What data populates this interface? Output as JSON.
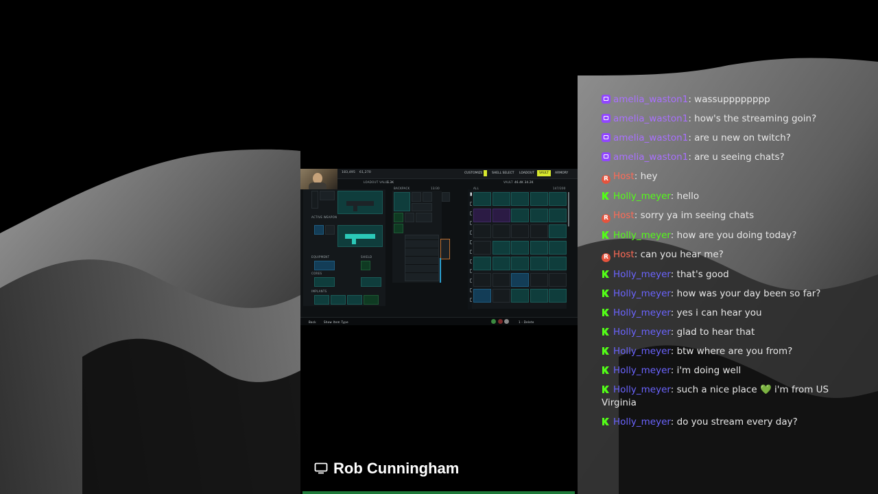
{
  "game": {
    "currency_a": "183,495",
    "currency_b": "61,270",
    "loadout_value_label": "LOADOUT VALUE",
    "loadout_value": "1.3K",
    "tabs": [
      "CUSTOMIZE",
      "SHELL SELECT",
      "LOADOUT",
      "VAULT",
      "ARMORY"
    ],
    "active_tab": "VAULT",
    "vault_label": "VAULT",
    "vault_values": "46.4K   34.2K",
    "backpack_label": "BACKPACK",
    "backpack_count": "13/30",
    "all_label": "ALL",
    "all_count": "147/200",
    "active_weapon_label": "ACTIVE WEAPON",
    "equipment_label": "EQUIPMENT",
    "shield_label": "SHIELD",
    "cores_label": "CORES",
    "implants_label": "IMPLANTS",
    "back_label": "Back",
    "show_item_type_label": "Show Item Type",
    "delete_label": "1 - Delete"
  },
  "streamer": {
    "name": "Rob Cunningham"
  },
  "chat": [
    {
      "user": "amelia_waston1",
      "badge": "twitch",
      "color": "#a970ff",
      "text": "wassupppppppp"
    },
    {
      "user": "amelia_waston1",
      "badge": "twitch",
      "color": "#a970ff",
      "text": "how's the streaming goin?"
    },
    {
      "user": "amelia_waston1",
      "badge": "twitch",
      "color": "#a970ff",
      "text": "are u new on twitch?"
    },
    {
      "user": "amelia_waston1",
      "badge": "twitch",
      "color": "#a970ff",
      "text": "are u seeing chats?"
    },
    {
      "user": "Host",
      "badge": "host",
      "color": "#ff6a55",
      "text": "hey"
    },
    {
      "user": "Holly_meyer",
      "badge": "kick",
      "color": "#53fc18",
      "text": "hello"
    },
    {
      "user": "Host",
      "badge": "host",
      "color": "#ff6a55",
      "text": "sorry ya im seeing chats"
    },
    {
      "user": "Holly_meyer",
      "badge": "kick",
      "color": "#53fc18",
      "text": "how are you doing today?"
    },
    {
      "user": "Host",
      "badge": "host",
      "color": "#ff6a55",
      "text": "can you hear me?"
    },
    {
      "user": "Holly_meyer",
      "badge": "kick",
      "color": "#6b64ff",
      "text": "that's good"
    },
    {
      "user": "Holly_meyer",
      "badge": "kick",
      "color": "#6b64ff",
      "text": "how was your day been so far?"
    },
    {
      "user": "Holly_meyer",
      "badge": "kick",
      "color": "#6b64ff",
      "text": "yes i can hear you"
    },
    {
      "user": "Holly_meyer",
      "badge": "kick",
      "color": "#6b64ff",
      "text": "glad to hear that"
    },
    {
      "user": "Holly_meyer",
      "badge": "kick",
      "color": "#6b64ff",
      "text": "btw where are you from?"
    },
    {
      "user": "Holly_meyer",
      "badge": "kick",
      "color": "#6b64ff",
      "text": "i'm doing well"
    },
    {
      "user": "Holly_meyer",
      "badge": "kick",
      "color": "#6b64ff",
      "text": "such a nice place",
      "emoji": "💚",
      "text2": "i'm from US Virginia"
    },
    {
      "user": "Holly_meyer",
      "badge": "kick",
      "color": "#6b64ff",
      "text": "do you stream every day?"
    }
  ]
}
